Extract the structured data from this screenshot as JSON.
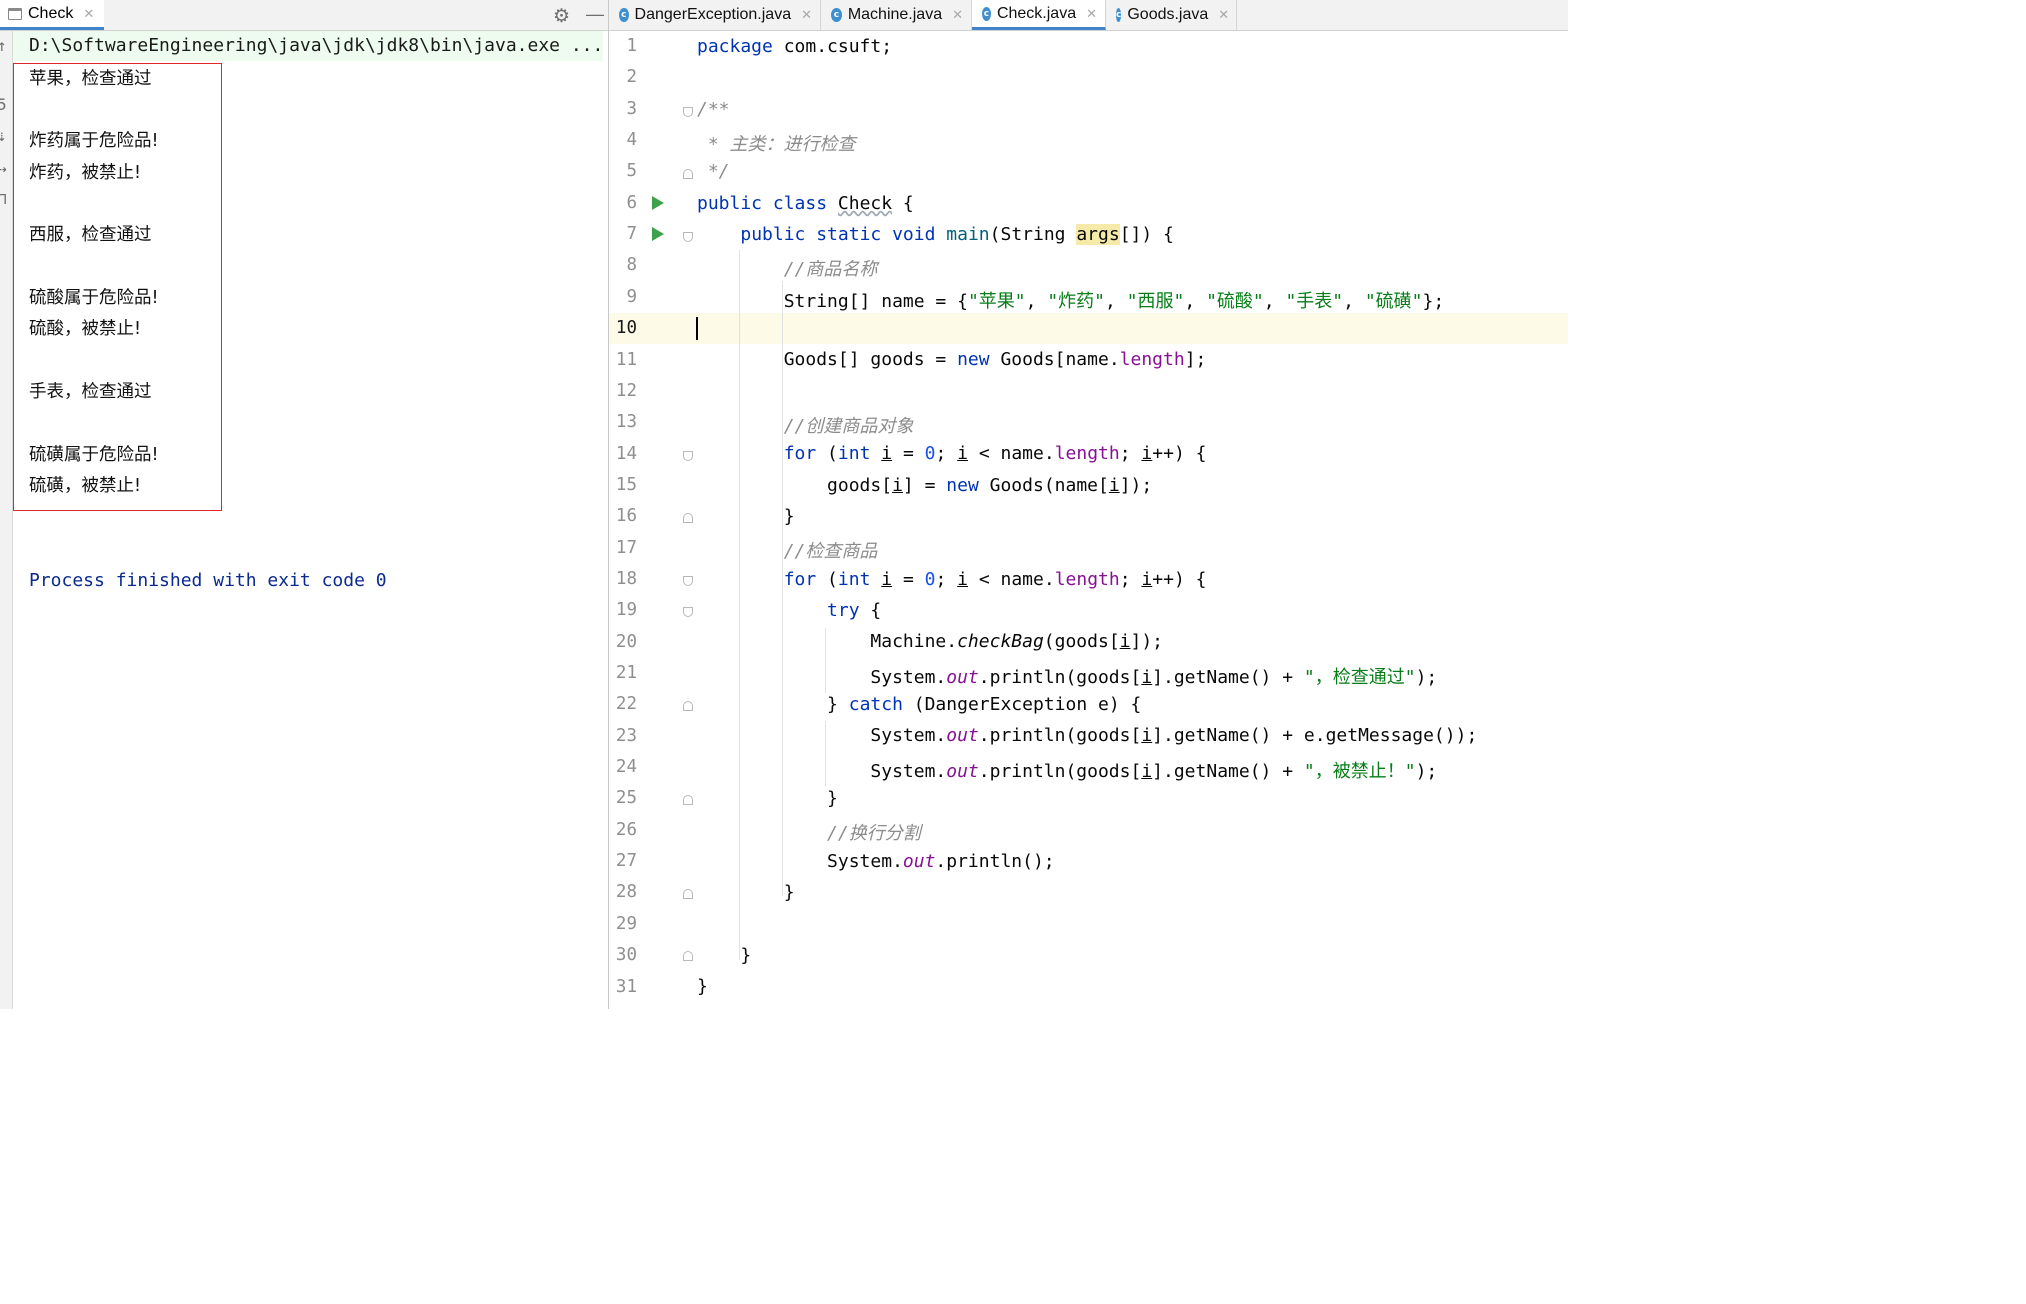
{
  "run_panel": {
    "tab_label": "Check",
    "command": "D:\\SoftwareEngineering\\java\\jdk\\jdk8\\bin\\java.exe ...",
    "output_lines": [
      "苹果，检查通过",
      "",
      "炸药属于危险品!",
      "炸药，被禁止!",
      "",
      "西服，检查通过",
      "",
      "硫酸属于危险品!",
      "硫酸，被禁止!",
      "",
      "手表，检查通过",
      "",
      "硫磺属于危险品!",
      "硫磺，被禁止!"
    ],
    "exit_message": "Process finished with exit code 0"
  },
  "editor": {
    "tabs": [
      {
        "label": "DangerException.java",
        "active": false
      },
      {
        "label": "Machine.java",
        "active": false
      },
      {
        "label": "Check.java",
        "active": true
      },
      {
        "label": "Goods.java",
        "active": false
      }
    ],
    "line_numbers": [
      "1",
      "2",
      "3",
      "4",
      "5",
      "6",
      "7",
      "8",
      "9",
      "10",
      "11",
      "12",
      "13",
      "14",
      "15",
      "16",
      "17",
      "18",
      "19",
      "20",
      "21",
      "22",
      "23",
      "24",
      "25",
      "26",
      "27",
      "28",
      "29",
      "30",
      "31"
    ],
    "current_line": 10,
    "code": {
      "l1_kw": "package",
      "l1_rest": " com.csuft;",
      "l3": "/**",
      "l4": " * 主类：进行检查",
      "l5": " */",
      "l6_kw": "public class",
      "l6_name": "Check",
      "l6_rest": " {",
      "l7_kw": "public static void",
      "l7_name": "main",
      "l7_a": "(String ",
      "l7_param": "args",
      "l7_b": "[]) {",
      "l8": "//商品名称",
      "l9_a": "String[] name = {",
      "l9_s1": "\"苹果\"",
      "l9_s2": "\"炸药\"",
      "l9_s3": "\"西服\"",
      "l9_s4": "\"硫酸\"",
      "l9_s5": "\"手表\"",
      "l9_s6": "\"硫磺\"",
      "sep": ", ",
      "l9_end": "};",
      "l11_a": "Goods[] goods = ",
      "kw_new": "new",
      "l11_b": " Goods[name.",
      "fld_length": "length",
      "l11_c": "];",
      "l13": "//创建商品对象",
      "kw_for": "for",
      "paren_open": " (",
      "kw_int": "int",
      "var_i": "i",
      "eq": " = ",
      "zero": "0",
      "lt": "; ",
      "cmp": " < name.",
      "semi_sp": "; ",
      "inc": "++) {",
      "l15_a": "goods[",
      "l15_b": "] = ",
      "l15_c": " Goods(name[",
      "l15_d": "]);",
      "brace_close": "}",
      "l17": "//检查商品",
      "kw_try": "try",
      "brace_open_sp": " {",
      "l20_a": "Machine.",
      "l20_m": "checkBag",
      "l20_b": "(goods[",
      "l20_c": "]);",
      "sys": "System.",
      "out": "out",
      "println_goods": ".println(goods[",
      "getname": "].getName() + ",
      "l21_str": "\"，检查通过\"",
      "close_paren_semi": ");",
      "l22_a": "} ",
      "kw_catch": "catch",
      "l22_b": " (DangerException e) {",
      "l23_end": "].getName() + e.getMessage());",
      "l24_str": "\"，被禁止！\"",
      "l26": "//换行分割",
      "l27_end": ".println();",
      "dot": "."
    }
  }
}
